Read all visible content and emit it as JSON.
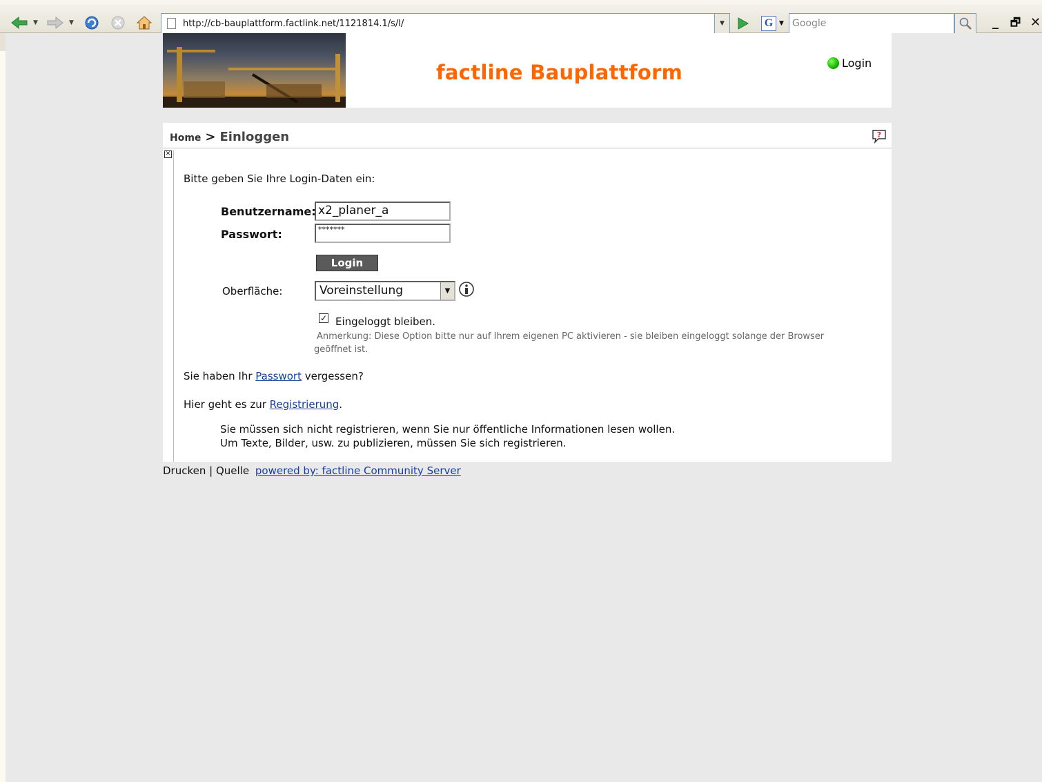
{
  "browser": {
    "url": "http://cb-bauplattform.factlink.net/1121814.1/s/l/",
    "search_placeholder": "Google",
    "min_label": "_",
    "restore_label": "🗗",
    "close_label": "✕"
  },
  "header": {
    "site_title": "factline Bauplattform",
    "login_label": "Login"
  },
  "breadcrumb": {
    "home": "Home",
    "separator": ">",
    "current": "Einloggen"
  },
  "form": {
    "intro": "Bitte geben Sie Ihre Login-Daten ein:",
    "username_label": "Benutzername:",
    "username_value": "x2_planer_a",
    "password_label": "Passwort:",
    "password_value": "*******",
    "login_button": "Login",
    "surface_label": "Oberfläche:",
    "surface_selected": "Voreinstellung",
    "stay_logged_label": "Eingeloggt bleiben.",
    "stay_logged_checked": true,
    "note": "Anmerkung: Diese Option bitte nur auf Ihrem eigenen PC aktivieren - sie bleiben eingeloggt solange der Browser geöffnet ist."
  },
  "forgot": {
    "prefix": "Sie haben Ihr ",
    "link": "Passwort",
    "suffix": " vergessen?"
  },
  "register": {
    "prefix": "Hier geht es zur ",
    "link": "Registrierung",
    "suffix": ".",
    "info_line1": "Sie müssen sich nicht registrieren, wenn Sie nur öffentliche Informationen lesen wollen.",
    "info_line2": "Um Texte, Bilder, usw. zu publizieren, müssen Sie sich registrieren."
  },
  "footer": {
    "print": "Drucken",
    "divider": "|",
    "source": "Quelle",
    "powered": "powered by: factline Community Server"
  },
  "colors": {
    "title_orange": "#ff6600",
    "link_blue": "#1a3c9c",
    "page_bg": "#e9e9e9"
  }
}
